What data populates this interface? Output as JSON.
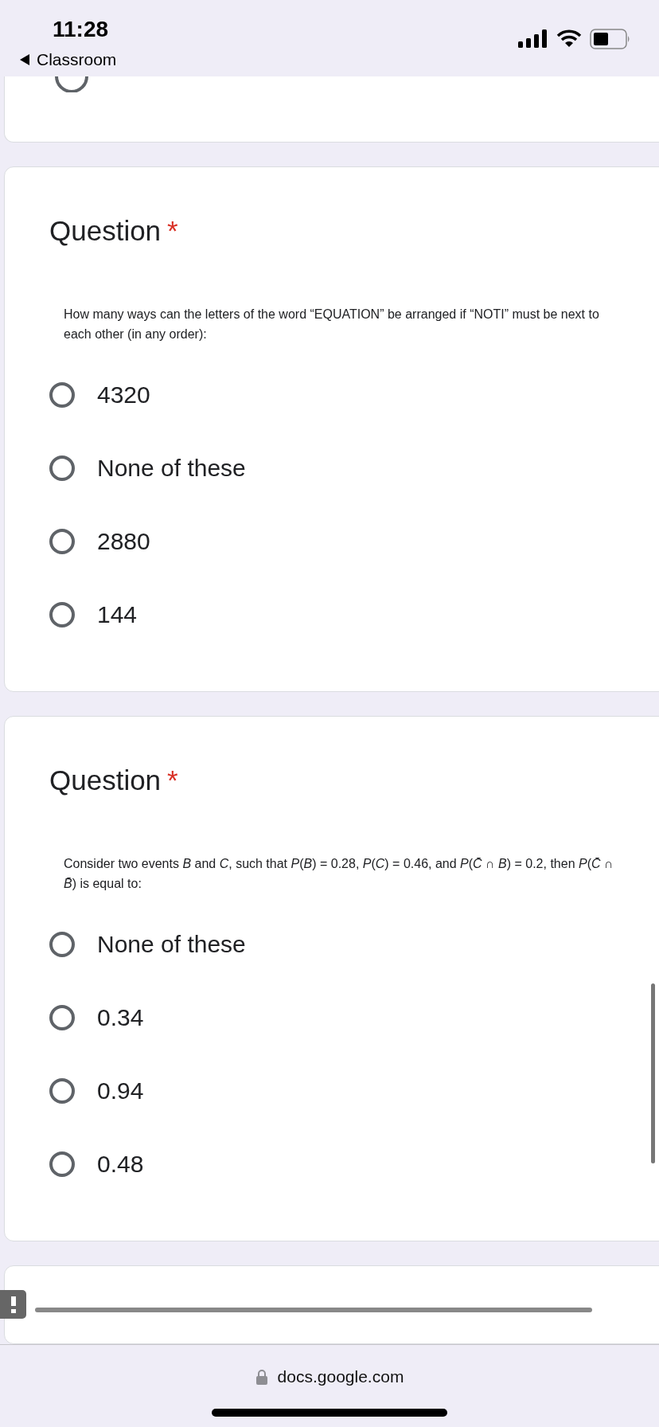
{
  "status_bar": {
    "time": "11:28",
    "back_label": "Classroom"
  },
  "questions": [
    {
      "title": "Question",
      "required_mark": "*",
      "text": "How many ways can the letters of the word “EQUATION” be arranged if “NOTI” must be next to each other (in any order):",
      "options": [
        {
          "label": "4320",
          "selected": false
        },
        {
          "label": "None of these",
          "selected": false
        },
        {
          "label": "2880",
          "selected": false
        },
        {
          "label": "144",
          "selected": false
        }
      ]
    },
    {
      "title": "Question",
      "required_mark": "*",
      "text": "Consider two events *B* and *C*, such that *P*(*B*) = 0.28,  *P*(*C*) = 0.46,  and *P*(*C̄* ∩ *B*) = 0.2, then *P*(*C̄* ∩ *B̄*) is equal to:",
      "options": [
        {
          "label": "None of these",
          "selected": false
        },
        {
          "label": "0.34",
          "selected": false
        },
        {
          "label": "0.94",
          "selected": false
        },
        {
          "label": "0.48",
          "selected": false
        }
      ]
    }
  ],
  "browser": {
    "url": "docs.google.com"
  }
}
